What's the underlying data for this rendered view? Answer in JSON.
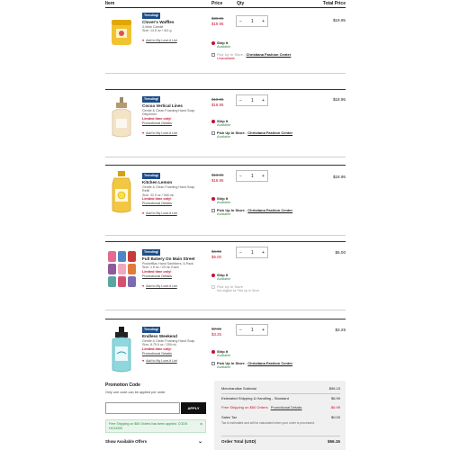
{
  "header": {
    "item": "Item",
    "price": "Price",
    "qty": "Qty",
    "total_price": "Total Price"
  },
  "items": [
    {
      "badge": "Trending!",
      "name": "Clover's Waffles",
      "meta": [
        "3-Wick Candle",
        "Size: 14.5 oz / 411 g"
      ],
      "limited": "",
      "promo": "",
      "wishlist": "Add to My Love-it List",
      "old_price": "$39.95",
      "new_price": "$19.95",
      "qty": "1",
      "total": "$19.95",
      "ship_label": "Ship It",
      "ship_status": "Available",
      "pickup_label": "Pick Up In Store",
      "pickup_sep": " - ",
      "store": "Christiana Fashion Center",
      "pickup_status": "Unavailable",
      "pickup_note": ""
    },
    {
      "badge": "Trending!",
      "name": "Cocoa Vertical Lines",
      "meta": [
        "Gentle & Clean Foaming Hand Soap",
        "Dispenser"
      ],
      "limited": "Limited time only!",
      "promo": "Promotional Details",
      "wishlist": "Add to My Love-it List",
      "old_price": "$18.95",
      "new_price": "$18.95",
      "qty": "1",
      "total": "$18.95",
      "ship_label": "Ship It",
      "ship_status": "Available",
      "pickup_label": "Pick Up In Store",
      "pickup_sep": " - ",
      "store": "Christiana Fashion Center",
      "pickup_status": "Available",
      "pickup_note": ""
    },
    {
      "badge": "Trending!",
      "name": "Kitchen Lemon",
      "meta": [
        "Gentle & Clean Foaming Hand Soap",
        "Refill",
        "Size: 32 fl oz / 946 mL"
      ],
      "limited": "Limited time only!",
      "promo": "Promotional Details",
      "wishlist": "Add to My Love-it List",
      "old_price": "$13.95",
      "new_price": "$18.95",
      "qty": "1",
      "total": "$18.95",
      "ship_label": "Ship It",
      "ship_status": "Available",
      "pickup_label": "Pick Up In Store",
      "pickup_sep": " - ",
      "store": "Christiana Fashion Center",
      "pickup_status": "Available",
      "pickup_note": ""
    },
    {
      "badge": "Trending!",
      "name": "Full Bakery On Main Street",
      "meta": [
        "PocketBac Hand Sanitizers, 5-Pack",
        "Size: 1 fl oz / 29 mL Each"
      ],
      "limited": "Limited time only!",
      "promo": "Promotional Details",
      "wishlist": "Add to My Love-it List",
      "old_price": "$6.95",
      "new_price": "$5.00",
      "qty": "1",
      "total": "$5.00",
      "ship_label": "Ship It",
      "ship_status": "Available",
      "pickup_label": "Pick Up In Store",
      "pickup_sep": "",
      "store": "",
      "pickup_status": "",
      "pickup_note": "Not eligible for Pick Up In Store"
    },
    {
      "badge": "Trending!",
      "name": "Endless Weekend",
      "meta": [
        "Gentle & Clean Foaming Hand Soap",
        "Size: 8.75 fl oz / 259 mL"
      ],
      "limited": "Limited time only!",
      "promo": "Promotional Details",
      "wishlist": "Add to My Love-it List",
      "old_price": "$7.95",
      "new_price": "$3.25",
      "qty": "1",
      "total": "$3.25",
      "ship_label": "Ship It",
      "ship_status": "Available",
      "pickup_label": "Pick Up In Store",
      "pickup_sep": " - ",
      "store": "Christiana Fashion Center",
      "pickup_status": "Available",
      "pickup_note": ""
    }
  ],
  "qty_minus": "−",
  "qty_plus": "+",
  "promo": {
    "title": "Promotion Code",
    "subtitle": "Only one code can be applied per order",
    "apply": "APPLY",
    "input_placeholder": "",
    "note": "Free Shipping on $50 Orders has been applied. CODE: HC24290",
    "close": "×",
    "offers": "Show Available Offers",
    "offers_chev": "⌄"
  },
  "summary": {
    "subtotal_label": "Merchandise Subtotal",
    "subtotal": "$56.15",
    "shipping_label": "Estimated Shipping & Handling - Standard",
    "shipping": "$6.99",
    "free_label": "Free Shipping on $50 Orders",
    "free_link": "Promotional Details",
    "free": "-$6.99",
    "tax_label": "Sales Tax",
    "tax": "$0.00",
    "tax_note": "Tax is estimated and will be calculated when your order is processed.",
    "total_label": "Order Total (USD)",
    "total": "$56.15"
  },
  "colors": {
    "accent": "#c8102e",
    "badge": "#1d4e89",
    "available": "#2a8a3e"
  }
}
